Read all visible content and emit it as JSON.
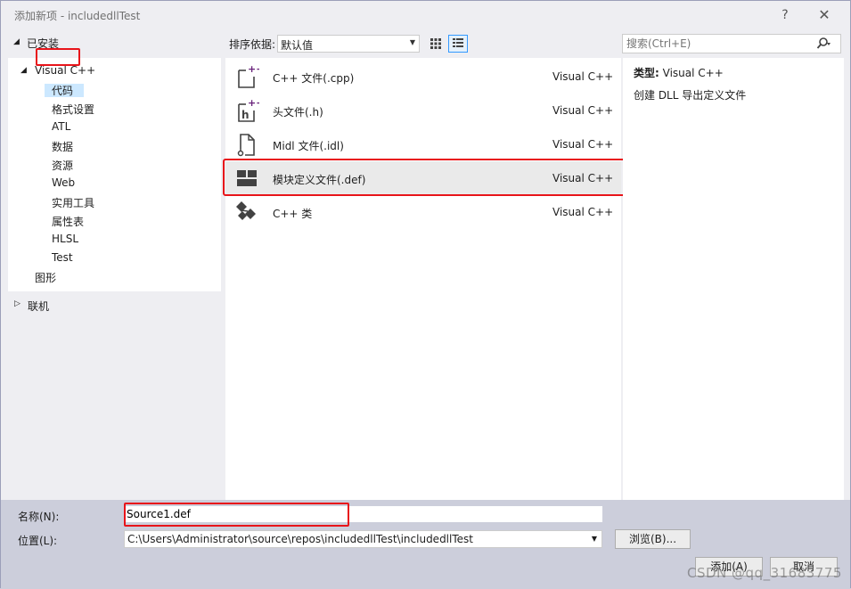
{
  "window": {
    "title": "添加新项 - includedllTest",
    "help_glyph": "?",
    "close_glyph": "✕"
  },
  "left": {
    "installed_label": "已安装",
    "tree": {
      "root": "Visual C++",
      "children": [
        "代码",
        "格式设置",
        "ATL",
        "数据",
        "资源",
        "Web",
        "实用工具",
        "属性表",
        "HLSL",
        "Test"
      ],
      "sibling": "图形"
    },
    "online_label": "联机"
  },
  "sort": {
    "label": "排序依据:",
    "value": "默认值"
  },
  "search": {
    "placeholder": "搜索(Ctrl+E)"
  },
  "templates": [
    {
      "name": "C++ 文件(.cpp)",
      "lang": "Visual C++",
      "icon": "cpp-file-icon"
    },
    {
      "name": "头文件(.h)",
      "lang": "Visual C++",
      "icon": "header-file-icon"
    },
    {
      "name": "Midl 文件(.idl)",
      "lang": "Visual C++",
      "icon": "midl-file-icon"
    },
    {
      "name": "模块定义文件(.def)",
      "lang": "Visual C++",
      "icon": "def-file-icon"
    },
    {
      "name": "C++ 类",
      "lang": "Visual C++",
      "icon": "cpp-class-icon"
    }
  ],
  "details": {
    "type_label": "类型:",
    "type_value": "Visual C++",
    "description": "创建 DLL 导出定义文件"
  },
  "form": {
    "name_label": "名称(N):",
    "name_value": "Source1.def",
    "location_label": "位置(L):",
    "location_value": "C:\\Users\\Administrator\\source\\repos\\includedllTest\\includedllTest",
    "browse_label": "浏览(B)...",
    "add_label": "添加(A)",
    "cancel_label": "取消"
  },
  "watermark": "CSDN @qq_31683775"
}
